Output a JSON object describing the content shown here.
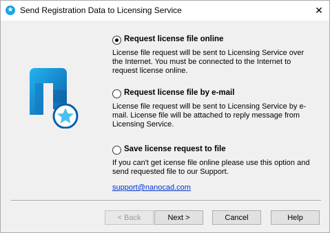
{
  "window": {
    "title": "Send Registration Data to Licensing Service",
    "close_glyph": "✕"
  },
  "options": [
    {
      "label": "Request license file online",
      "checked": true,
      "description": "License file request will be sent to Licensing Service over the Internet. You must be connected to the Internet to request license online."
    },
    {
      "label": "Request license file by e-mail",
      "checked": false,
      "description": "License file request will be sent to Licensing Service by e-mail. License file will be attached to reply message from Licensing Service."
    },
    {
      "label": "Save license request to file",
      "checked": false,
      "description": "If you can't get icense file online please use this option and send requested file to our Support."
    }
  ],
  "support_link": "support@nanocad.com",
  "buttons": {
    "back": "< Back",
    "next": "Next >",
    "cancel": "Cancel",
    "help": "Help"
  },
  "icons": {
    "app": "star-badge-icon",
    "logo": "nanocad-logo"
  },
  "colors": {
    "accent": "#1aa3e8",
    "link": "#0033cc"
  }
}
